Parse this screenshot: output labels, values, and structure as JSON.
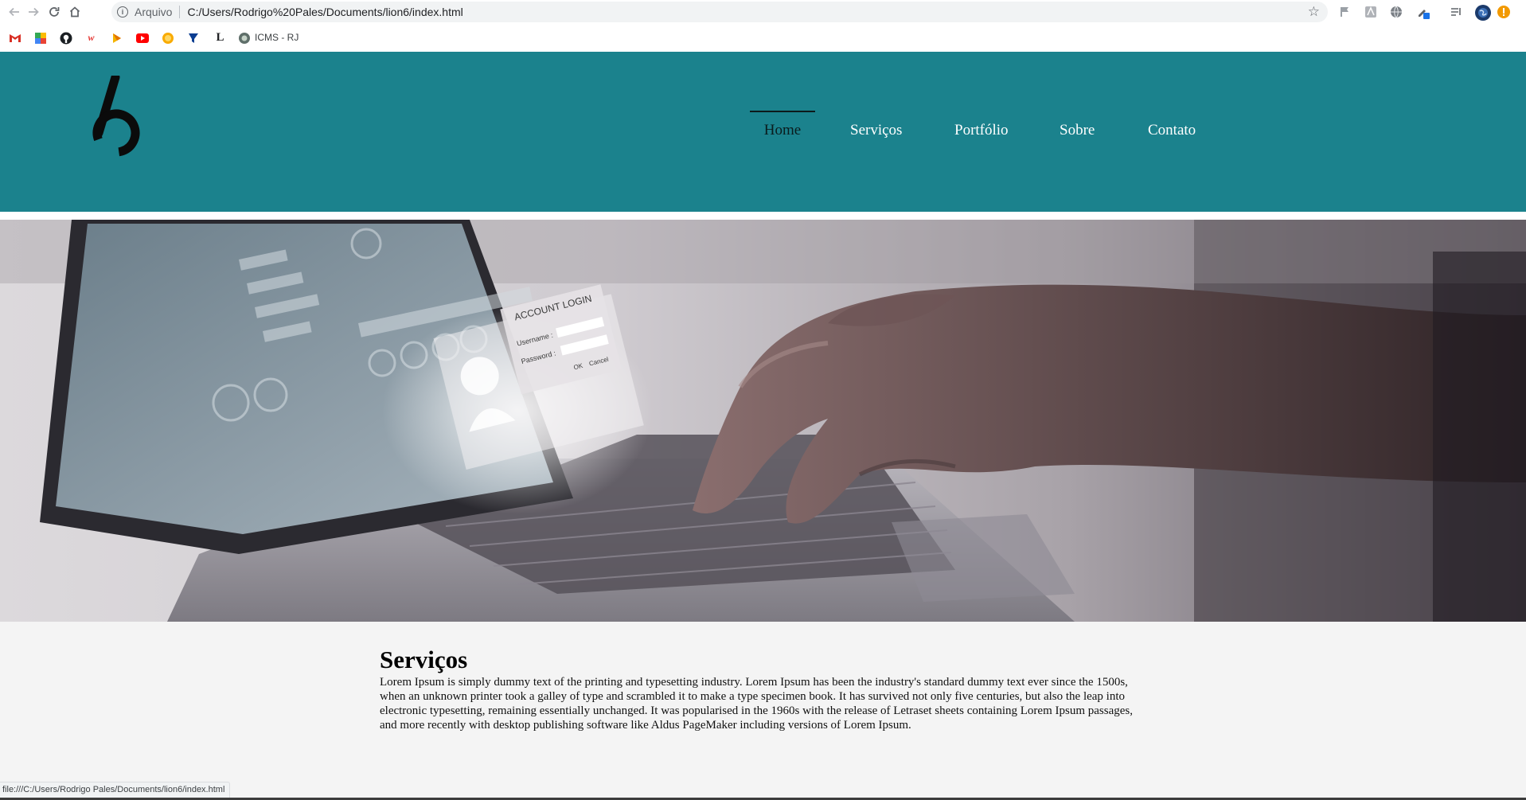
{
  "browser": {
    "address_scheme": "Arquivo",
    "address_url": "C:/Users/Rodrigo%20Pales/Documents/lion6/index.html",
    "bookmark_label": "ICMS - RJ",
    "status_url": "file:///C:/Users/Rodrigo Pales/Documents/lion6/index.html"
  },
  "nav": {
    "items": [
      {
        "label": "Home",
        "active": true
      },
      {
        "label": "Serviços",
        "active": false
      },
      {
        "label": "Portfólio",
        "active": false
      },
      {
        "label": "Sobre",
        "active": false
      },
      {
        "label": "Contato",
        "active": false
      }
    ]
  },
  "hero": {
    "login_title": "ACCOUNT LOGIN",
    "username_label": "Username :",
    "password_label": "Password :",
    "ok_label": "OK",
    "cancel_label": "Cancel"
  },
  "services": {
    "title": "Serviços",
    "text": "Lorem Ipsum is simply dummy text of the printing and typesetting industry. Lorem Ipsum has been the industry's standard dummy text ever since the 1500s, when an unknown printer took a galley of type and scrambled it to make a type specimen book. It has survived not only five centuries, but also the leap into electronic typesetting, remaining essentially unchanged. It was popularised in the 1960s with the release of Letraset sheets containing Lorem Ipsum passages, and more recently with desktop publishing software like Aldus PageMaker including versions of Lorem Ipsum."
  },
  "colors": {
    "header_bg": "#1b828d",
    "active_nav": "#0a1c1e",
    "content_bg": "#f4f4f4"
  },
  "icons": [
    "back-arrow-icon",
    "forward-arrow-icon",
    "reload-icon",
    "home-icon",
    "info-icon",
    "star-icon",
    "gmail-icon",
    "github-icon",
    "youtube-icon",
    "logo-mark"
  ]
}
